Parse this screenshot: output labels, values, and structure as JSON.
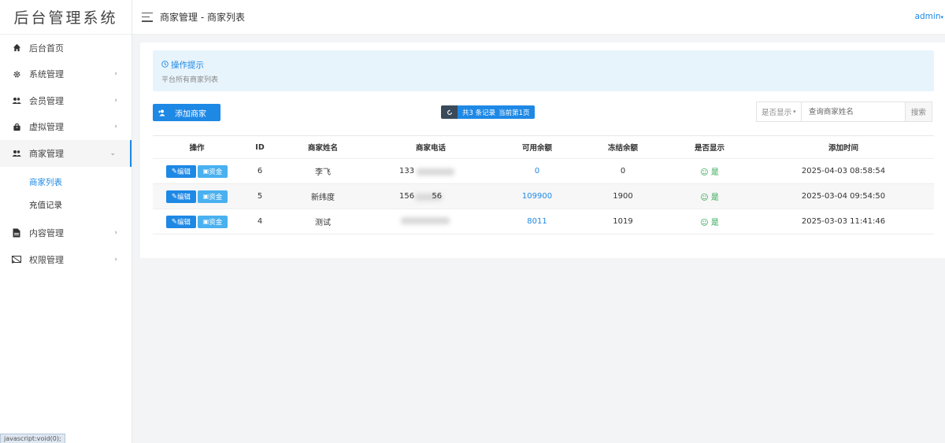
{
  "app": {
    "logo": "后台管理系统"
  },
  "sidebar": {
    "items": [
      {
        "label": "后台首页",
        "icon": "home-icon"
      },
      {
        "label": "系统管理",
        "icon": "gear-icon",
        "chevron": "›"
      },
      {
        "label": "会员管理",
        "icon": "users-icon",
        "chevron": "›"
      },
      {
        "label": "虚拟管理",
        "icon": "bag-icon",
        "chevron": "›"
      },
      {
        "label": "商家管理",
        "icon": "users-icon",
        "chevron": "⌄",
        "active": true
      },
      {
        "label": "内容管理",
        "icon": "document-icon",
        "chevron": "›"
      },
      {
        "label": "权限管理",
        "icon": "cast-icon",
        "chevron": "›"
      }
    ],
    "submenu": [
      {
        "label": "商家列表",
        "active": true
      },
      {
        "label": "充值记录"
      }
    ]
  },
  "header": {
    "breadcrumb": "商家管理 - 商家列表",
    "user": "admin",
    "user_caret": "▾"
  },
  "tip": {
    "title": "操作提示",
    "desc": "平台所有商家列表"
  },
  "toolbar": {
    "add_label": "添加商家",
    "count_text": "共3 条记录",
    "page_text": "当前第1页",
    "filter_select": "是否显示",
    "search_placeholder": "查询商家姓名",
    "search_label": "搜索"
  },
  "table": {
    "headers": [
      "操作",
      "ID",
      "商家姓名",
      "商家电话",
      "可用余额",
      "冻结余额",
      "是否显示",
      "添加时间"
    ],
    "edit_label": "编辑",
    "fund_label": "资金",
    "rows": [
      {
        "id": "6",
        "name": "李飞",
        "phone": "133",
        "balance": "0",
        "frozen": "0",
        "show": "是",
        "time": "2025-04-03 08:58:54"
      },
      {
        "id": "5",
        "name": "新纬度",
        "phone": "156       56",
        "balance": "109900",
        "frozen": "1900",
        "show": "是",
        "time": "2025-03-04 09:54:50"
      },
      {
        "id": "4",
        "name": "测试",
        "phone": "",
        "balance": "8011",
        "frozen": "1019",
        "show": "是",
        "time": "2025-03-03 11:41:46"
      }
    ]
  },
  "statusbar": {
    "text": "javascript:void(0);"
  },
  "colors": {
    "accent": "#1e88e5",
    "fund_button": "#4ab1f0",
    "success": "#2ea44f",
    "tip_bg": "#e8f4fc"
  }
}
